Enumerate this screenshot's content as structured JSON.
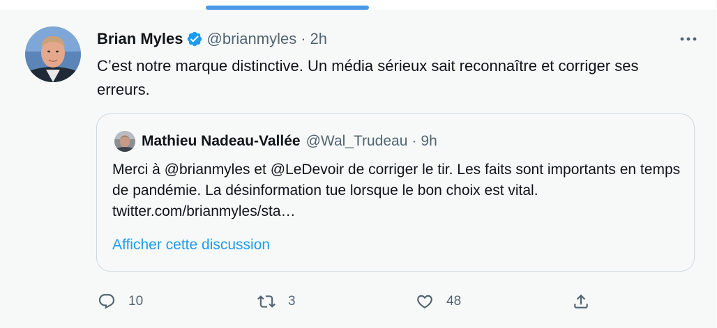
{
  "tweet": {
    "author": {
      "display_name": "Brian Myles",
      "handle": "@brianmyles",
      "verified": true,
      "avatar_icon": "profile-photo"
    },
    "time": "2h",
    "text": "C’est notre marque distinctive. Un média sérieux sait reconnaître et corriger ses erreurs.",
    "more_icon": "more-horizontal-icon"
  },
  "quoted_tweet": {
    "author": {
      "display_name": "Mathieu Nadeau-Vallée",
      "handle": "@Wal_Trudeau",
      "avatar_icon": "profile-photo"
    },
    "time": "9h",
    "text": "Merci à @brianmyles et @LeDevoir de corriger le tir. Les faits sont importants en temps de pandémie. La désinformation tue lorsque le bon choix est vital. twitter.com/brianmyles/sta…",
    "show_thread_label": "Afficher cette discussion"
  },
  "actions": {
    "reply": {
      "icon": "reply-icon",
      "count": "10"
    },
    "retweet": {
      "icon": "retweet-icon",
      "count": "3"
    },
    "like": {
      "icon": "heart-icon",
      "count": "48"
    },
    "share": {
      "icon": "share-icon",
      "count": ""
    }
  },
  "colors": {
    "accent": "#1d9bf0",
    "muted_text": "#536471",
    "card_background": "#f7f9f9",
    "border": "#cfd9de"
  }
}
